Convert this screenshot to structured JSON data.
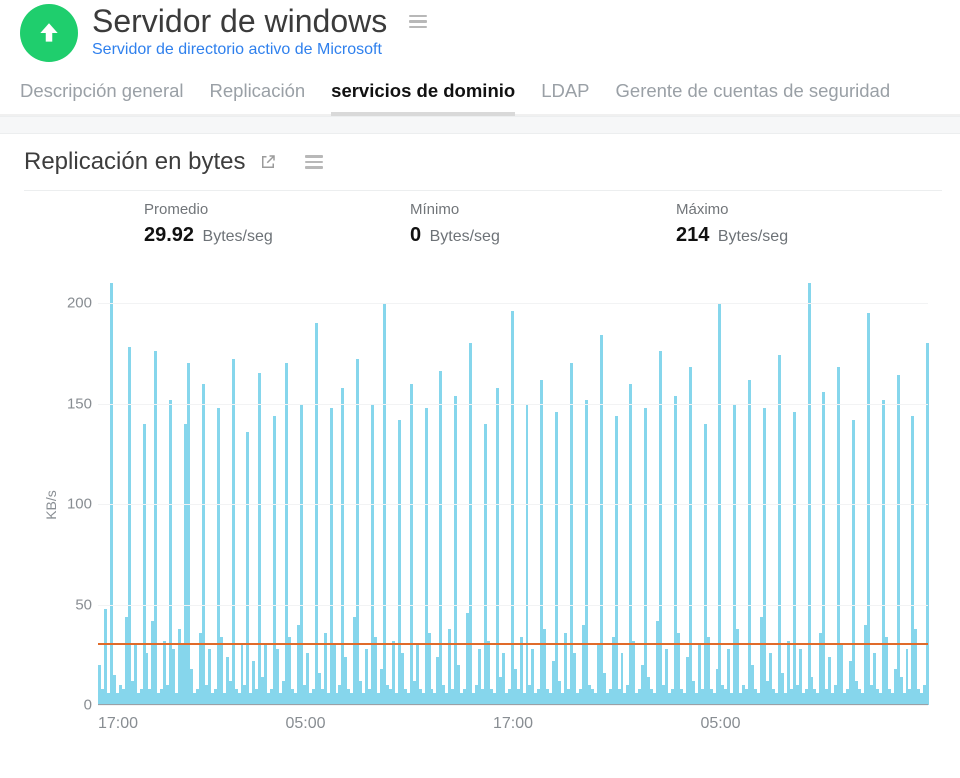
{
  "header": {
    "title": "Servidor de windows",
    "subtitle": "Servidor de directorio activo de Microsoft"
  },
  "tabs": [
    {
      "label": "Descripción general",
      "active": false
    },
    {
      "label": "Replicación",
      "active": false
    },
    {
      "label": "servicios de dominio",
      "active": true
    },
    {
      "label": "LDAP",
      "active": false
    },
    {
      "label": "Gerente de cuentas de seguridad",
      "active": false
    }
  ],
  "card": {
    "title": "Replicación en bytes"
  },
  "stats": {
    "avg": {
      "label": "Promedio",
      "value": "29.92",
      "unit": "Bytes/seg"
    },
    "min": {
      "label": "Mínimo",
      "value": "0",
      "unit": "Bytes/seg"
    },
    "max": {
      "label": "Máximo",
      "value": "214",
      "unit": "Bytes/seg"
    }
  },
  "chart_data": {
    "type": "area",
    "ylabel": "KB/s",
    "ylim": [
      0,
      214
    ],
    "y_ticks": [
      0,
      50,
      100,
      150,
      200
    ],
    "x_ticks": [
      {
        "pos": 0.0,
        "label": "17:00"
      },
      {
        "pos": 0.25,
        "label": "05:00"
      },
      {
        "pos": 0.5,
        "label": "17:00"
      },
      {
        "pos": 0.75,
        "label": "05:00"
      }
    ],
    "avg_line": 29.92,
    "values": [
      20,
      8,
      48,
      6,
      210,
      15,
      6,
      10,
      8,
      44,
      178,
      12,
      30,
      6,
      8,
      140,
      26,
      8,
      42,
      176,
      6,
      8,
      32,
      10,
      152,
      28,
      6,
      38,
      30,
      140,
      170,
      18,
      6,
      8,
      36,
      160,
      10,
      28,
      6,
      8,
      148,
      34,
      6,
      24,
      12,
      172,
      8,
      6,
      30,
      10,
      136,
      6,
      22,
      8,
      165,
      14,
      30,
      6,
      8,
      144,
      28,
      6,
      12,
      170,
      34,
      8,
      6,
      40,
      150,
      10,
      26,
      6,
      8,
      190,
      16,
      8,
      36,
      6,
      148,
      30,
      6,
      10,
      158,
      24,
      8,
      6,
      44,
      172,
      12,
      6,
      28,
      8,
      150,
      34,
      6,
      18,
      200,
      10,
      8,
      32,
      6,
      142,
      26,
      8,
      6,
      160,
      12,
      30,
      8,
      6,
      148,
      36,
      8,
      6,
      24,
      166,
      10,
      6,
      38,
      8,
      154,
      20,
      6,
      8,
      46,
      180,
      6,
      10,
      28,
      8,
      140,
      32,
      8,
      6,
      158,
      14,
      26,
      6,
      8,
      196,
      18,
      8,
      34,
      6,
      150,
      10,
      28,
      6,
      8,
      162,
      38,
      8,
      6,
      22,
      146,
      12,
      6,
      36,
      8,
      170,
      26,
      6,
      8,
      40,
      152,
      10,
      8,
      6,
      30,
      184,
      16,
      6,
      8,
      34,
      144,
      8,
      26,
      6,
      10,
      160,
      32,
      6,
      8,
      20,
      148,
      14,
      8,
      6,
      42,
      176,
      10,
      28,
      6,
      8,
      154,
      36,
      8,
      6,
      24,
      168,
      12,
      6,
      30,
      8,
      140,
      34,
      8,
      6,
      18,
      200,
      10,
      8,
      28,
      6,
      150,
      38,
      6,
      10,
      8,
      162,
      20,
      8,
      6,
      44,
      148,
      12,
      26,
      8,
      6,
      174,
      16,
      6,
      32,
      8,
      146,
      10,
      28,
      6,
      8,
      210,
      14,
      8,
      6,
      36,
      156,
      8,
      24,
      6,
      10,
      168,
      30,
      6,
      8,
      22,
      142,
      12,
      8,
      6,
      40,
      195,
      10,
      26,
      8,
      6,
      152,
      34,
      8,
      6,
      18,
      164,
      14,
      6,
      28,
      8,
      144,
      38,
      8,
      6,
      10,
      180
    ]
  }
}
